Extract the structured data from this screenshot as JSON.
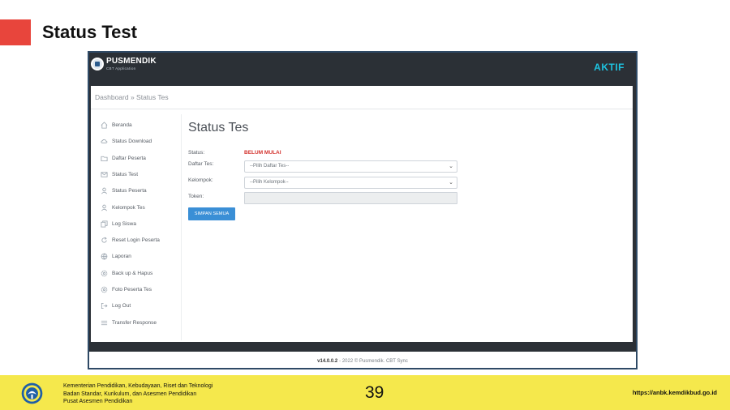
{
  "slide": {
    "title": "Status Test",
    "page_number": "39",
    "ministry_lines": [
      "Kementerian Pendidikan, Kebudayaan, Riset dan Teknologi",
      "Badan Standar, Kurikulum, dan Asesmen Pendidikan",
      "Pusat Asesmen Pendidikan"
    ],
    "url": "https://anbk.kemdikbud.go.id"
  },
  "app": {
    "logo_name": "PUSMENDIK",
    "logo_sub": "CBT Application",
    "status": "AKTIF",
    "breadcrumb": "Dashboard » Status Tes",
    "sidebar": [
      {
        "label": "Beranda",
        "icon": "home-icon"
      },
      {
        "label": "Status Download",
        "icon": "cloud-icon"
      },
      {
        "label": "Daftar Peserta",
        "icon": "folder-icon"
      },
      {
        "label": "Status Test",
        "icon": "mail-icon"
      },
      {
        "label": "Status Peserta",
        "icon": "user-icon"
      },
      {
        "label": "Kelompok Tes",
        "icon": "user-icon"
      },
      {
        "label": "Log Siswa",
        "icon": "copy-icon"
      },
      {
        "label": "Reset Login Peserta",
        "icon": "refresh-icon"
      },
      {
        "label": "Laporan",
        "icon": "globe-icon"
      },
      {
        "label": "Back up & Hapus",
        "icon": "gear-icon"
      },
      {
        "label": "Foto Peserta Tes",
        "icon": "gear-icon"
      },
      {
        "label": "Log Out",
        "icon": "logout-icon"
      },
      {
        "label": "Transfer Response",
        "icon": "list-icon"
      }
    ],
    "page_title": "Status Tes",
    "form": {
      "status_label": "Status:",
      "status_value": "BELUM MULAI",
      "daftar_label": "Daftar Tes:",
      "daftar_selected": "--Pilih Daftar Tes--",
      "kelompok_label": "Kelompok:",
      "kelompok_selected": "--Pilih Kelompok--",
      "token_label": "Token:",
      "token_value": "",
      "save_label": "SIMPAN SEMUA"
    },
    "footer_version": "v14.0.0.2",
    "footer_rest": "- 2022 © Pusmendik. CBT Sync"
  }
}
